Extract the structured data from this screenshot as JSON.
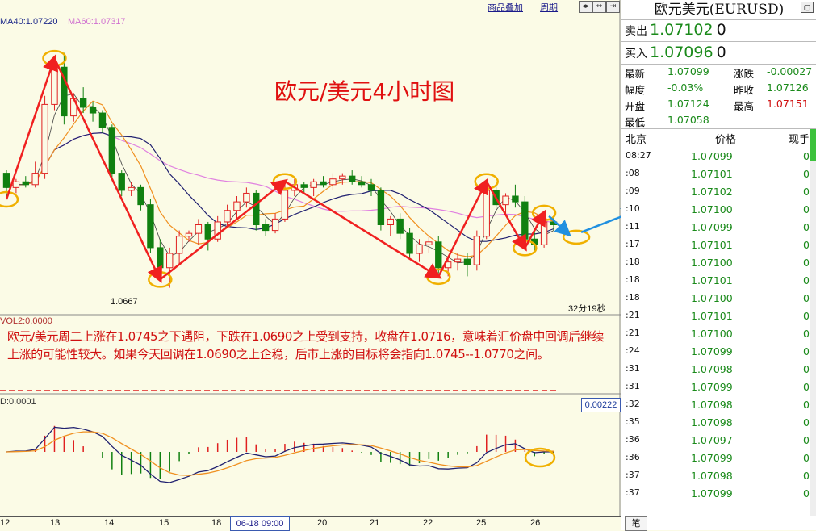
{
  "toolbar": {
    "overlay_label": "商品叠加",
    "period_label": "周期"
  },
  "indicators": {
    "ma40_label": "MA40:1.07220",
    "ma60_label": "MA60:1.07317",
    "vol_label": "VOL2:0.0000",
    "macd_label": "D:0.0001",
    "macd_value": "0.00222"
  },
  "chart_title": "欧元/美元4小时图",
  "low_label": "1.0667",
  "countdown": "32分19秒",
  "commentary": "欧元/美元周二上涨在1.0745之下遇阻，下跌在1.0690之上受到支持，收盘在1.0716，意味着汇价盘中回调后继续上涨的可能性较大。如果今天回调在1.0690之上企稳，后市上涨的目标将会指向1.0745--1.0770之间。",
  "colors": {
    "up": "#e02020",
    "down": "#108010",
    "ma_orange": "#f09020",
    "ma_navy": "#202070",
    "ma_pink": "#e080e0",
    "circle": "#f0b000",
    "arrow_red": "#f02020",
    "arrow_blue": "#2090e0"
  },
  "chart_data": {
    "type": "candlestick",
    "title": "欧元/美元4小时图",
    "x_tick_labels": [
      "12",
      "13",
      "14",
      "15",
      "18",
      "19",
      "20",
      "21",
      "22",
      "25",
      "26"
    ],
    "cursor_date": "06-18 09:00",
    "ylim": [
      1.066,
      1.076
    ],
    "candles": [
      [
        1.0708,
        1.0709,
        1.07,
        1.0703
      ],
      [
        1.0703,
        1.0706,
        1.0701,
        1.0705
      ],
      [
        1.0705,
        1.0707,
        1.0703,
        1.0704
      ],
      [
        1.0704,
        1.0712,
        1.0703,
        1.0708
      ],
      [
        1.0708,
        1.0735,
        1.0706,
        1.0732
      ],
      [
        1.0732,
        1.0747,
        1.073,
        1.0745
      ],
      [
        1.0745,
        1.075,
        1.0725,
        1.0728
      ],
      [
        1.0728,
        1.0736,
        1.0726,
        1.0734
      ],
      [
        1.0734,
        1.0738,
        1.0729,
        1.0731
      ],
      [
        1.0731,
        1.0733,
        1.0726,
        1.0729
      ],
      [
        1.0729,
        1.073,
        1.0722,
        1.0724
      ],
      [
        1.0724,
        1.0725,
        1.0706,
        1.0708
      ],
      [
        1.0708,
        1.0709,
        1.07,
        1.0702
      ],
      [
        1.0702,
        1.0705,
        1.07,
        1.0703
      ],
      [
        1.0703,
        1.0704,
        1.0695,
        1.0697
      ],
      [
        1.0697,
        1.0699,
        1.068,
        1.0682
      ],
      [
        1.0682,
        1.0685,
        1.0672,
        1.0675
      ],
      [
        1.0675,
        1.0682,
        1.0668,
        1.068
      ],
      [
        1.068,
        1.0688,
        1.0676,
        1.0686
      ],
      [
        1.0686,
        1.0688,
        1.0684,
        1.0687
      ],
      [
        1.0687,
        1.0692,
        1.0683,
        1.069
      ],
      [
        1.069,
        1.0691,
        1.0681,
        1.0685
      ],
      [
        1.0685,
        1.0693,
        1.0684,
        1.0691
      ],
      [
        1.0691,
        1.0697,
        1.0689,
        1.0695
      ],
      [
        1.0695,
        1.07,
        1.0692,
        1.0698
      ],
      [
        1.0698,
        1.0703,
        1.0696,
        1.0701
      ],
      [
        1.0701,
        1.0702,
        1.0688,
        1.069
      ],
      [
        1.069,
        1.0692,
        1.0686,
        1.0688
      ],
      [
        1.0688,
        1.0694,
        1.0687,
        1.0692
      ],
      [
        1.0692,
        1.0704,
        1.0691,
        1.0702
      ],
      [
        1.0702,
        1.0706,
        1.07,
        1.0704
      ],
      [
        1.0704,
        1.0705,
        1.0701,
        1.0703
      ],
      [
        1.0703,
        1.0706,
        1.07,
        1.0705
      ],
      [
        1.0705,
        1.0707,
        1.0703,
        1.0704
      ],
      [
        1.0704,
        1.0708,
        1.0702,
        1.0706
      ],
      [
        1.0706,
        1.0708,
        1.0704,
        1.0707
      ],
      [
        1.0707,
        1.0709,
        1.0704,
        1.0705
      ],
      [
        1.0705,
        1.0707,
        1.0703,
        1.0704
      ],
      [
        1.0704,
        1.0706,
        1.07,
        1.0702
      ],
      [
        1.0702,
        1.0703,
        1.0688,
        1.069
      ],
      [
        1.069,
        1.0693,
        1.0686,
        1.0692
      ],
      [
        1.0692,
        1.0694,
        1.0685,
        1.0687
      ],
      [
        1.0687,
        1.0689,
        1.0678,
        1.068
      ],
      [
        1.068,
        1.0685,
        1.0677,
        1.0683
      ],
      [
        1.0683,
        1.0686,
        1.068,
        1.0684
      ],
      [
        1.0684,
        1.0686,
        1.0673,
        1.0675
      ],
      [
        1.0675,
        1.0679,
        1.0672,
        1.0677
      ],
      [
        1.0677,
        1.068,
        1.0674,
        1.0678
      ],
      [
        1.0678,
        1.068,
        1.0672,
        1.0676
      ],
      [
        1.0676,
        1.0688,
        1.0674,
        1.0686
      ],
      [
        1.0686,
        1.0704,
        1.0685,
        1.0702
      ],
      [
        1.0702,
        1.0704,
        1.0695,
        1.0697
      ],
      [
        1.0697,
        1.0701,
        1.0694,
        1.07
      ],
      [
        1.07,
        1.0704,
        1.0696,
        1.0698
      ],
      [
        1.0698,
        1.07,
        1.0683,
        1.0685
      ],
      [
        1.0685,
        1.0688,
        1.068,
        1.0683
      ],
      [
        1.0683,
        1.0693,
        1.0682,
        1.0691
      ],
      [
        1.0691,
        1.0693,
        1.0688,
        1.069
      ]
    ]
  },
  "quote": {
    "title": "欧元美元(EURUSD)",
    "sell_label": "卖出",
    "sell_price": "1.07102",
    "sell_vol": "0",
    "buy_label": "买入",
    "buy_price": "1.07096",
    "buy_vol": "0",
    "stats": [
      {
        "k1": "最新",
        "v1": "1.07099",
        "c1": "g",
        "k2": "涨跌",
        "v2": "-0.00027",
        "c2": "g"
      },
      {
        "k1": "幅度",
        "v1": "-0.03%",
        "c1": "g",
        "k2": "昨收",
        "v2": "1.07126",
        "c2": "g"
      },
      {
        "k1": "开盘",
        "v1": "1.07124",
        "c1": "g",
        "k2": "最高",
        "v2": "1.07151",
        "c2": "r"
      },
      {
        "k1": "最低",
        "v1": "1.07058",
        "c1": "g",
        "k2": "",
        "v2": "",
        "c2": "g"
      }
    ],
    "ticks_header": {
      "time": "北京",
      "price": "价格",
      "vol": "现手"
    },
    "ticks": [
      {
        "t": "08:27",
        "p": "1.07099",
        "n": "0"
      },
      {
        "t": ":08",
        "p": "1.07101",
        "n": "0"
      },
      {
        "t": ":09",
        "p": "1.07102",
        "n": "0"
      },
      {
        "t": ":10",
        "p": "1.07100",
        "n": "0"
      },
      {
        "t": ":11",
        "p": "1.07099",
        "n": "0"
      },
      {
        "t": ":17",
        "p": "1.07101",
        "n": "0"
      },
      {
        "t": ":18",
        "p": "1.07100",
        "n": "0"
      },
      {
        "t": ":18",
        "p": "1.07101",
        "n": "0"
      },
      {
        "t": ":18",
        "p": "1.07100",
        "n": "0"
      },
      {
        "t": ":21",
        "p": "1.07101",
        "n": "0"
      },
      {
        "t": ":21",
        "p": "1.07100",
        "n": "0"
      },
      {
        "t": ":24",
        "p": "1.07099",
        "n": "0"
      },
      {
        "t": ":31",
        "p": "1.07098",
        "n": "0"
      },
      {
        "t": ":31",
        "p": "1.07099",
        "n": "0"
      },
      {
        "t": ":32",
        "p": "1.07098",
        "n": "0"
      },
      {
        "t": ":35",
        "p": "1.07098",
        "n": "0"
      },
      {
        "t": ":36",
        "p": "1.07097",
        "n": "0"
      },
      {
        "t": ":36",
        "p": "1.07099",
        "n": "0"
      },
      {
        "t": ":37",
        "p": "1.07098",
        "n": "0"
      },
      {
        "t": ":37",
        "p": "1.07099",
        "n": "0"
      }
    ],
    "bottom_tab": "笔"
  }
}
